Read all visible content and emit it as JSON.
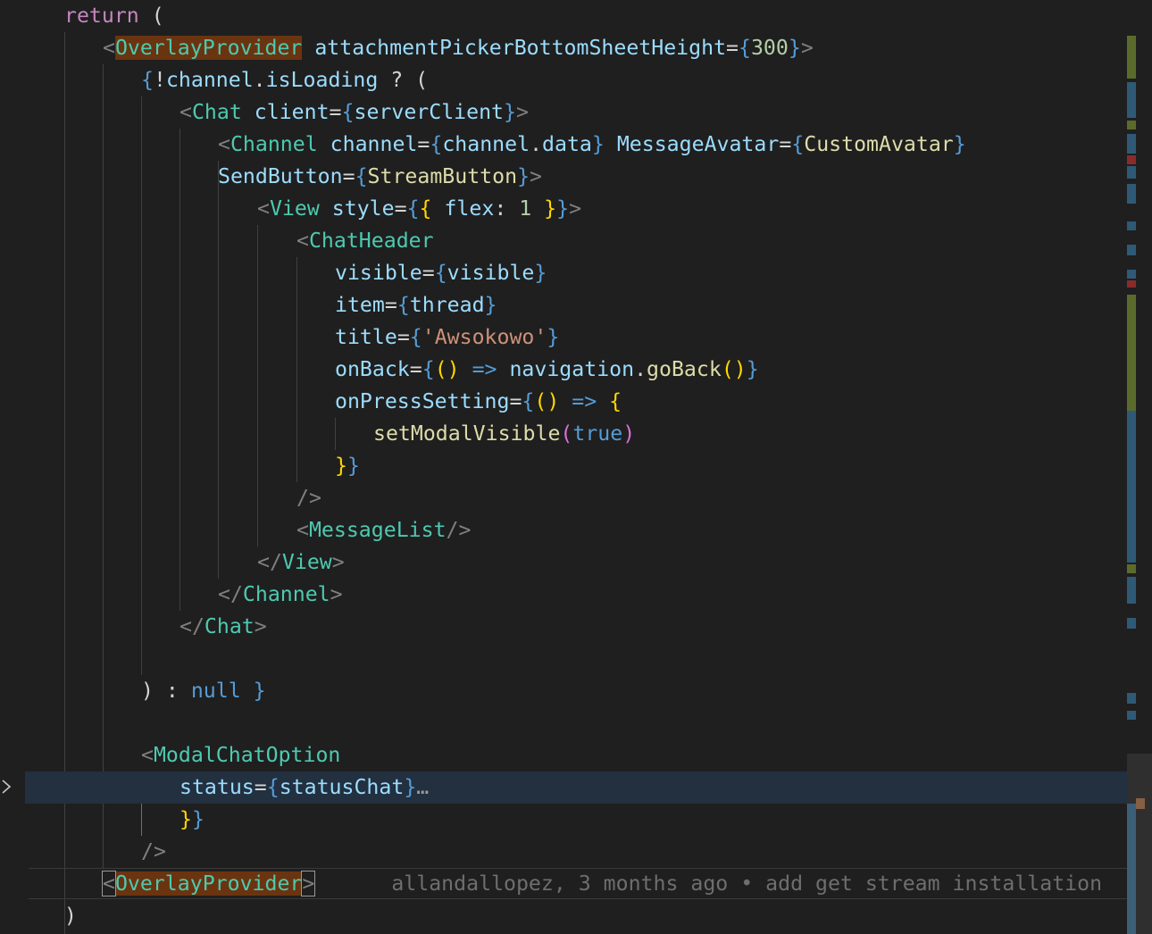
{
  "code": {
    "l1": {
      "kw": "return",
      "rest": " ("
    },
    "l2": {
      "open": "<",
      "tag": "OverlayProvider",
      "attr": "attachmentPickerBottomSheetHeight",
      "eq": "=",
      "lb": "{",
      "num": "300",
      "rb": "}",
      "close": ">"
    },
    "l3": {
      "lb": "{",
      "bang": "!",
      "obj": "channel",
      "dot": ".",
      "prop": "isLoading",
      "tern": " ? ("
    },
    "l4": {
      "open": "<",
      "tag": "Chat",
      "attr": "client",
      "eq": "=",
      "lb": "{",
      "val": "serverClient",
      "rb": "}",
      "close": ">"
    },
    "l5": {
      "open": "<",
      "tag": "Channel",
      "attr1": "channel",
      "eq": "=",
      "lb": "{",
      "val1a": "channel",
      "dot": ".",
      "val1b": "data",
      "rb": "}",
      "attr2": "MessageAvatar",
      "val2": "CustomAvatar"
    },
    "l6": {
      "attr": "SendButton",
      "eq": "=",
      "lb": "{",
      "val": "StreamButton",
      "rb": "}",
      "close": ">"
    },
    "l7": {
      "open": "<",
      "tag": "View",
      "attr": "style",
      "eq": "=",
      "lb": "{",
      "inner_lb": "{",
      "key": " flex",
      "colon": ": ",
      "num": "1",
      "inner_rb": " }",
      "rb": "}",
      "close": ">"
    },
    "l8": {
      "open": "<",
      "tag": "ChatHeader"
    },
    "l9": {
      "attr": "visible",
      "eq": "=",
      "lb": "{",
      "val": "visible",
      "rb": "}"
    },
    "l10": {
      "attr": "item",
      "eq": "=",
      "lb": "{",
      "val": "thread",
      "rb": "}"
    },
    "l11": {
      "attr": "title",
      "eq": "=",
      "lb": "{",
      "str": "'Awsokowo'",
      "rb": "}"
    },
    "l12": {
      "attr": "onBack",
      "eq": "=",
      "lb": "{",
      "paren": "()",
      "arrow": " => ",
      "obj": "navigation",
      "dot": ".",
      "fn": "goBack",
      "call": "()",
      "rb": "}"
    },
    "l13": {
      "attr": "onPressSetting",
      "eq": "=",
      "lb": "{",
      "paren": "()",
      "arrow": " => ",
      "brace": "{"
    },
    "l14": {
      "fn": "setModalVisible",
      "lp": "(",
      "lit": "true",
      "rp": ")"
    },
    "l15": {
      "brace": "}",
      "rb": "}"
    },
    "l16": {
      "selfclose": "/>"
    },
    "l17": {
      "open": "<",
      "tag": "MessageList",
      "close": "/>"
    },
    "l18": {
      "open": "</",
      "tag": "View",
      "close": ">"
    },
    "l19": {
      "open": "</",
      "tag": "Channel",
      "close": ">"
    },
    "l20": {
      "open": "</",
      "tag": "Chat",
      "close": ">"
    },
    "l22": {
      "rp": ") ",
      "colon": ": ",
      "lit": "null",
      "rb": " }"
    },
    "l24": {
      "open": "<",
      "tag": "ModalChatOption"
    },
    "l25": {
      "attr": "status",
      "eq": "=",
      "lb": "{",
      "val": "statusChat",
      "rb": "}",
      "fold": "…"
    },
    "l26": {
      "brace": "}",
      "rb": "}"
    },
    "l27": {
      "selfclose": "/>"
    },
    "l28": {
      "open": "<",
      "slash": "/",
      "tag": "OverlayProvider",
      "close": ">"
    },
    "l29": {
      "rp": ")"
    }
  },
  "blame": {
    "text": "allandallopez, 3 months ago • add get stream installation"
  },
  "icons": {
    "fold_chevron": "chevron-right-icon"
  }
}
